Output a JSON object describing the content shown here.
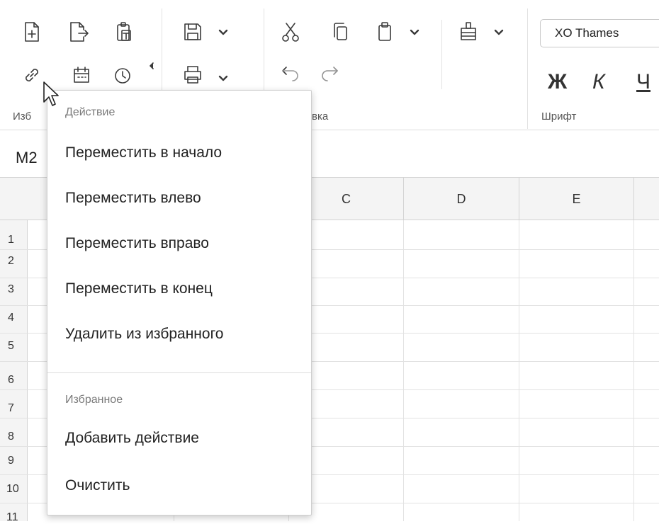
{
  "toolbar": {
    "group_labels": {
      "favorites": "Изб",
      "edit": "вка",
      "font": "Шрифт"
    },
    "font_name": "XO Thames",
    "format": {
      "bold": "Ж",
      "italic": "К",
      "underline": "Ч"
    }
  },
  "formula_bar": {
    "cell_ref": "M2"
  },
  "grid": {
    "columns": [
      "C",
      "D",
      "E"
    ],
    "rows": [
      "1",
      "2",
      "3",
      "4",
      "5",
      "6",
      "7",
      "8",
      "9",
      "10",
      "11"
    ]
  },
  "context_menu": {
    "section_action": "Действие",
    "items_action": [
      "Переместить в начало",
      "Переместить влево",
      "Переместить вправо",
      "Переместить в конец",
      "Удалить из избранного"
    ],
    "section_favorites": "Избранное",
    "items_favorites": [
      "Добавить действие",
      "Очистить"
    ]
  }
}
